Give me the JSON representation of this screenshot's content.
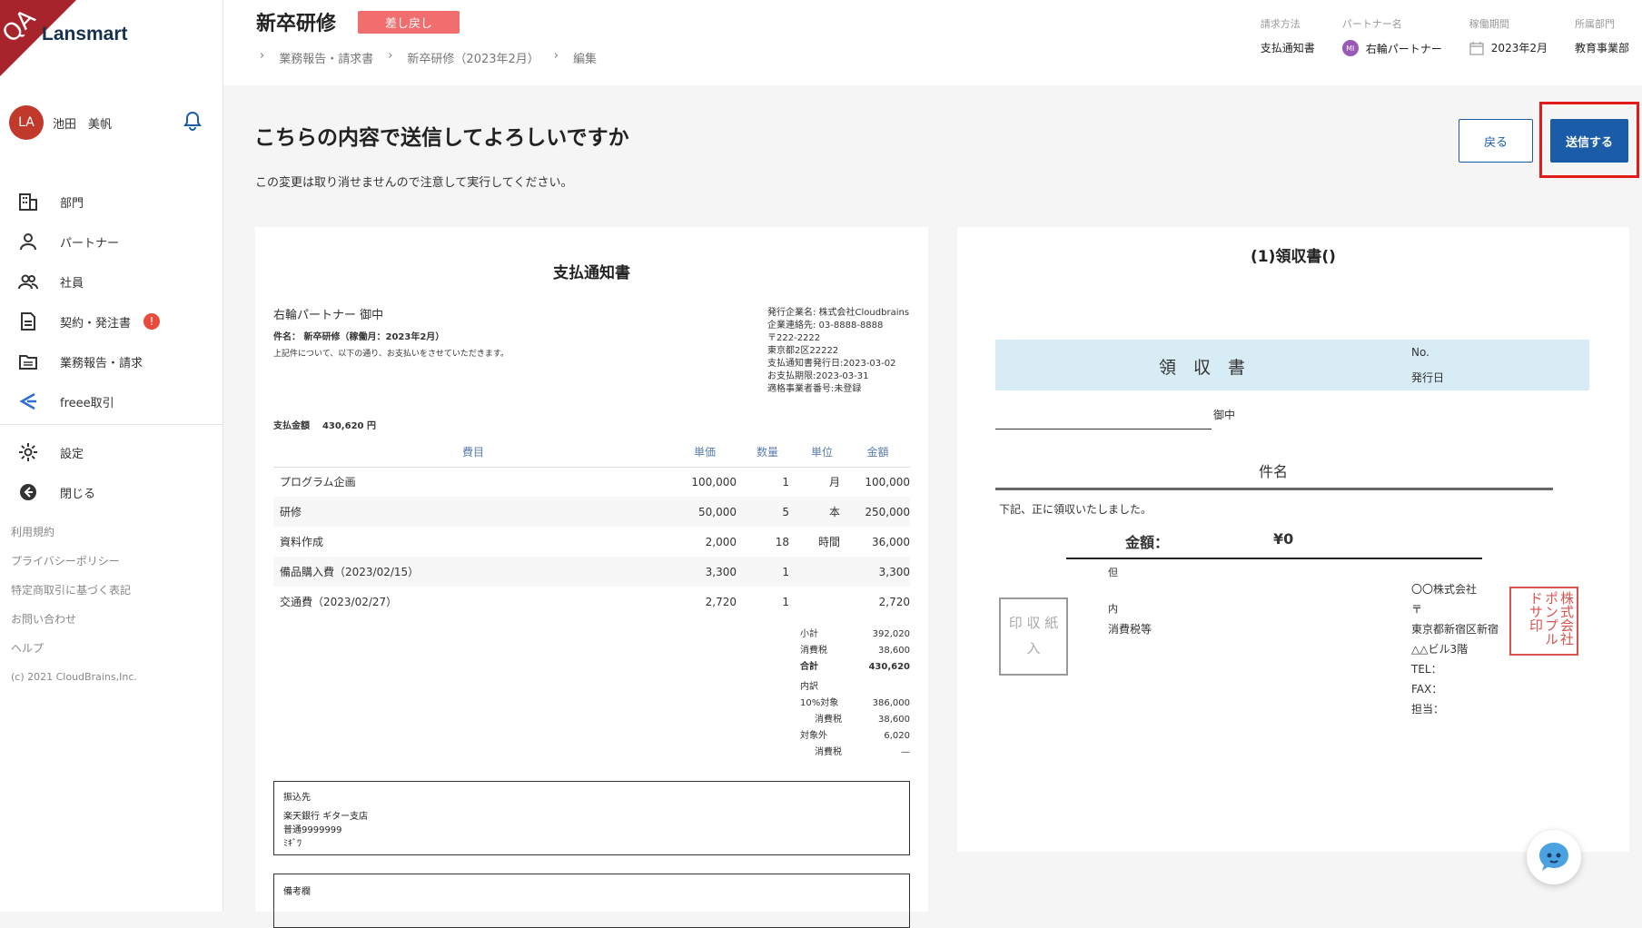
{
  "brand": {
    "qa": "QA",
    "logo": "Lansmart"
  },
  "user": {
    "initials": "LA",
    "name": "池田　美帆"
  },
  "nav": [
    {
      "label": "部門"
    },
    {
      "label": "パートナー"
    },
    {
      "label": "社員"
    },
    {
      "label": "契約・発注書",
      "badge": "!"
    },
    {
      "label": "業務報告・請求"
    },
    {
      "label": "freee取引"
    }
  ],
  "nav2": [
    {
      "label": "設定"
    },
    {
      "label": "閉じる"
    }
  ],
  "footer": [
    "利用規約",
    "プライバシーポリシー",
    "特定商取引に基づく表記",
    "お問い合わせ",
    "ヘルプ",
    "(c) 2021 CloudBrains,Inc."
  ],
  "header": {
    "title": "新卒研修",
    "status": "差し戻し",
    "breadcrumb": [
      "業務報告・請求書",
      "新卒研修（2023年2月）",
      "編集"
    ],
    "meta": [
      {
        "key": "請求方法",
        "value": "支払通知書"
      },
      {
        "key": "パートナー名",
        "value": "右輪パートナー",
        "avatar": "MI"
      },
      {
        "key": "稼働期間",
        "value": "2023年2月"
      },
      {
        "key": "所属部門",
        "value": "教育事業部"
      }
    ]
  },
  "confirm": {
    "title": "こちらの内容で送信してよろしいですか",
    "desc": "この変更は取り消せませんので注意して実行してください。",
    "back": "戻る",
    "send": "送信する"
  },
  "doc": {
    "title": "支払通知書",
    "to": "右輪パートナー 御中",
    "subject": "件名： 新卒研修（稼働月：2023年2月）",
    "intro": "上記件について、以下の通り、お支払いをさせていただきます。",
    "issuer": [
      "発行企業名: 株式会社Cloudbrains",
      "企業連絡先: 03-8888-8888",
      "〒222-2222",
      "東京都2区22222",
      "支払通知書発行日:2023-03-02",
      "お支払期限:2023-03-31",
      "適格事業者番号:未登録"
    ],
    "amount_label": "支払金額",
    "amount": "430,620 円",
    "columns": [
      "費目",
      "単価",
      "数量",
      "単位",
      "金額"
    ],
    "rows": [
      [
        "プログラム企画",
        "100,000",
        "1",
        "月",
        "100,000"
      ],
      [
        "研修",
        "50,000",
        "5",
        "本",
        "250,000"
      ],
      [
        "資料作成",
        "2,000",
        "18",
        "時間",
        "36,000"
      ],
      [
        "備品購入費（2023/02/15）",
        "3,300",
        "1",
        "",
        "3,300"
      ],
      [
        "交通費（2023/02/27）",
        "2,720",
        "1",
        "",
        "2,720"
      ]
    ],
    "summary": [
      [
        "小計",
        "392,020"
      ],
      [
        "消費税",
        "38,600"
      ],
      [
        "合計",
        "430,620"
      ],
      [
        "内訳",
        ""
      ],
      [
        "10%対象",
        "386,000"
      ],
      [
        "消費税",
        "38,600"
      ],
      [
        "対象外",
        "6,020"
      ],
      [
        "消費税",
        "—"
      ]
    ],
    "bank_label": "振込先",
    "bank": [
      "楽天銀行 ギター支店",
      "普通9999999",
      "ﾐｷﾞﾜ"
    ],
    "remarks_label": "備考欄"
  },
  "receipt": {
    "title": "(1)領収書()",
    "heading": "領　収　書",
    "no": "No.",
    "date": "発行日",
    "onchu": "御中",
    "subject": "件名",
    "received": "下記、正に領収いたしました。",
    "amount_label": "金額：",
    "amount": "¥0",
    "tadashi": "但",
    "uchi": "内",
    "tax": "消費税等",
    "inshi": "印 収 紙 入",
    "company": [
      "〇〇株式会社",
      "〒",
      "東京都新宿区新宿",
      "△△ビル3階",
      "TEL：",
      "FAX：",
      "担当："
    ],
    "stamp": "株式会社ポンプルドサ印"
  }
}
